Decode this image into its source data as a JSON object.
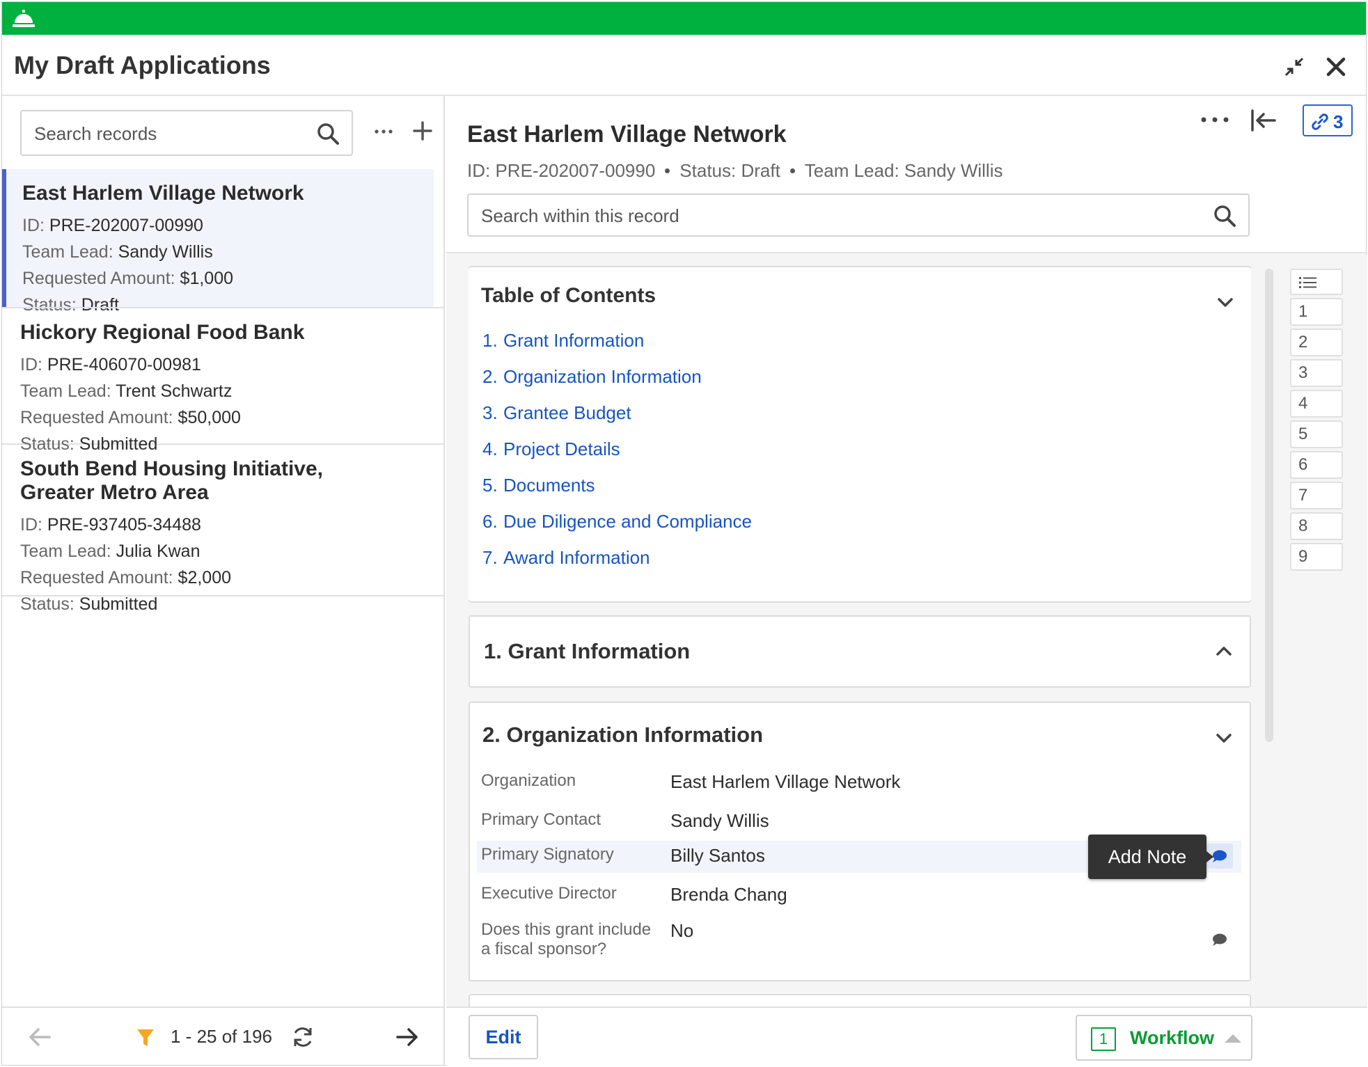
{
  "window": {
    "title": "My Draft Applications"
  },
  "colors": {
    "topbar": "#00b140",
    "link": "#1655c0",
    "accent": "#4a5fd0",
    "workflow": "#0a9b34",
    "filter": "#f5a623"
  },
  "left": {
    "search_placeholder": "Search records",
    "records": [
      {
        "name": "East Harlem Village Network",
        "id_label": "ID:",
        "id": "PRE-202007-00990",
        "lead_label": "Team Lead:",
        "lead": "Sandy Willis",
        "amount_label": "Requested Amount:",
        "amount": "$1,000",
        "status_label": "Status:",
        "status": "Draft"
      },
      {
        "name": "Hickory Regional Food Bank",
        "id_label": "ID:",
        "id": "PRE-406070-00981",
        "lead_label": "Team Lead:",
        "lead": "Trent Schwartz",
        "amount_label": "Requested Amount:",
        "amount": "$50,000",
        "status_label": "Status:",
        "status": "Submitted"
      },
      {
        "name": "South Bend Housing Initiative, Greater Metro Area",
        "id_label": "ID:",
        "id": "PRE-937405-34488",
        "lead_label": "Team Lead:",
        "lead": "Julia Kwan",
        "amount_label": "Requested Amount:",
        "amount": "$2,000",
        "status_label": "Status:",
        "status": "Submitted"
      }
    ],
    "pager": "1 - 25 of 196"
  },
  "detail": {
    "title": "East Harlem Village Network",
    "meta_id": "ID: PRE-202007-00990",
    "meta_status": "Status: Draft",
    "meta_lead": "Team Lead: Sandy Willis",
    "link_count": "3",
    "search_placeholder": "Search within this record",
    "toc": {
      "title": "Table of Contents",
      "items": [
        {
          "num": "1.",
          "label": "Grant Information"
        },
        {
          "num": "2.",
          "label": "Organization Information"
        },
        {
          "num": "3.",
          "label": "Grantee Budget"
        },
        {
          "num": "4.",
          "label": "Project Details"
        },
        {
          "num": "5.",
          "label": "Documents"
        },
        {
          "num": "6.",
          "label": "Due Diligence and Compliance"
        },
        {
          "num": "7.",
          "label": "Award Information"
        }
      ]
    },
    "section1_title": "1.  Grant Information",
    "section2": {
      "title": "2. Organization Information",
      "fields": [
        {
          "label": "Organization",
          "value": "East Harlem Village Network"
        },
        {
          "label": "Primary Contact",
          "value": "Sandy Willis"
        },
        {
          "label": "Primary Signatory",
          "value": "Billy Santos"
        },
        {
          "label": "Executive Director",
          "value": "Brenda Chang"
        },
        {
          "label_line1": "Does this grant include",
          "label_line2": "a fiscal sponsor?",
          "value": "No"
        }
      ]
    },
    "tooltip": "Add Note",
    "page_nav": [
      "1",
      "2",
      "3",
      "4",
      "5",
      "6",
      "7",
      "8",
      "9"
    ],
    "edit_label": "Edit",
    "workflow_count": "1",
    "workflow_label": "Workflow"
  }
}
